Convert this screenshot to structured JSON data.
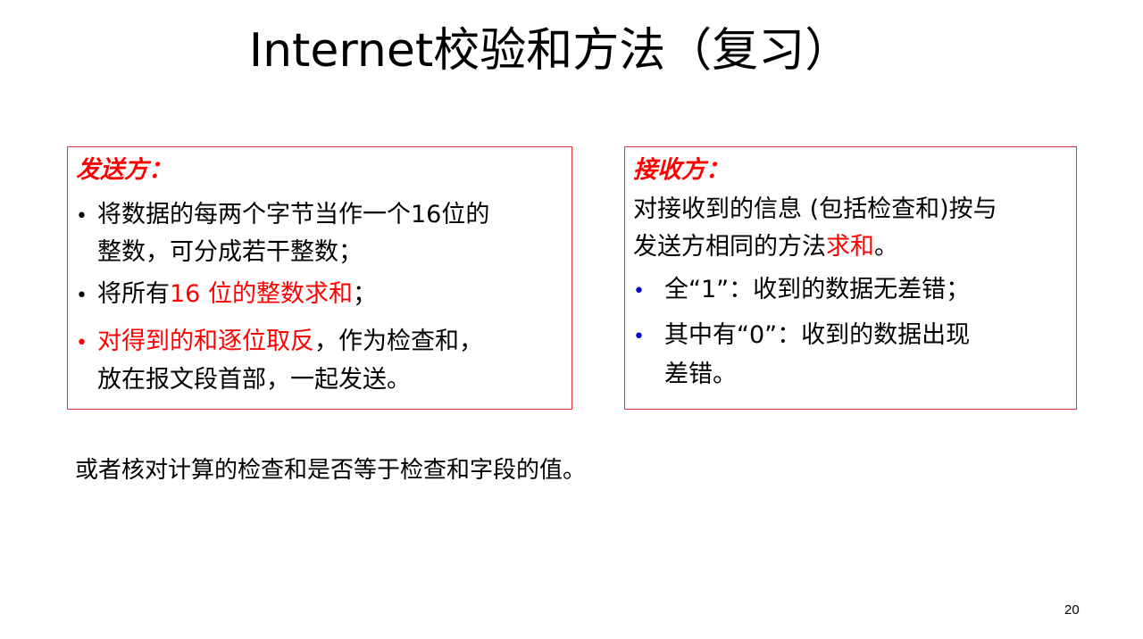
{
  "title": "Internet校验和方法（复习）",
  "sender": {
    "heading": "发送方：",
    "bullet1_line1": "将数据的每两个字节当作一个16位的",
    "bullet1_line2": "整数，可分成若干整数；",
    "bullet2_prefix": "将所有",
    "bullet2_red": "16 位的整数求和",
    "bullet2_suffix": "；",
    "bullet3_red": "对得到的和逐位取反",
    "bullet3_suffix": "，作为检查和，",
    "bullet3_line2": "放在报文段首部，一起发送。"
  },
  "receiver": {
    "heading": "接收方：",
    "line1": "对接收到的信息 (包括检查和)按与",
    "line2_prefix": "发送方相同的方法",
    "line2_red": "求和",
    "line2_suffix": "。",
    "bullet1": "全“1”：收到的数据无差错；",
    "bullet2_line1": "其中有“0”：收到的数据出现",
    "bullet2_line2": "差错。"
  },
  "footer_note": "或者核对计算的检查和是否等于检查和字段的值。",
  "page_number": "20",
  "colors": {
    "accent_red": "#ff0000",
    "box_border": "#e0313a",
    "bullet_blue": "#0000cc"
  }
}
